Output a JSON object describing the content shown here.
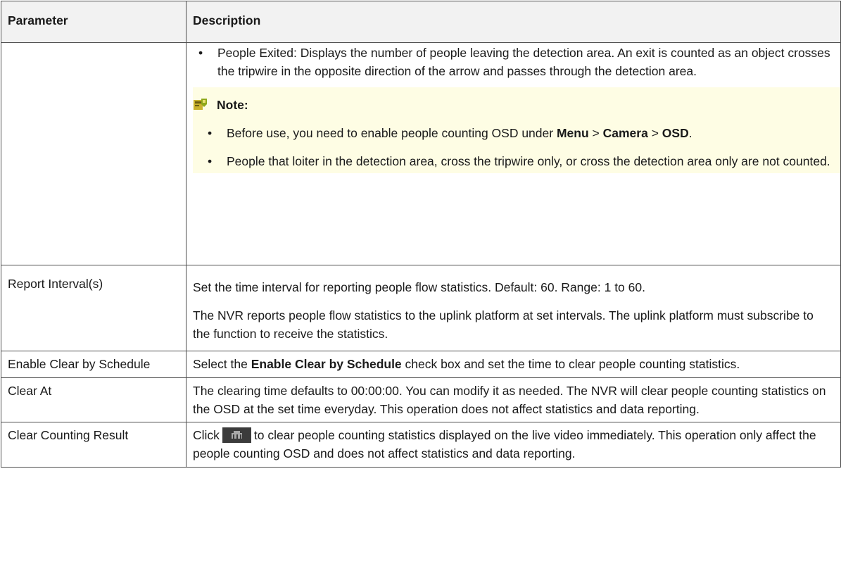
{
  "table": {
    "headers": {
      "parameter": "Parameter",
      "description": "Description"
    },
    "row1": {
      "param": "",
      "bullet": "People Exited: Displays the number of people leaving the detection area. An exit is counted as an object crosses the tripwire in the opposite direction of the arrow and passes through the detection area.",
      "note_title": "Note:",
      "note_item1": {
        "t1": "Before use, you need to enable people counting OSD under ",
        "b1": "Menu",
        "t2": " > ",
        "b2": "Camera",
        "t3": " > ",
        "b3": "OSD",
        "t4": "."
      },
      "note_item2": "People that loiter in the detection area, cross the tripwire only, or cross the detection area only are not counted."
    },
    "row2": {
      "param": "Report Interval(s)",
      "p1": "Set the time interval for reporting people flow statistics. Default: 60. Range: 1 to 60.",
      "p2": "The NVR reports people flow statistics to the uplink platform at set intervals. The uplink platform must subscribe to the function to receive the statistics."
    },
    "row3": {
      "param": "Enable Clear by Schedule",
      "t1": "Select the ",
      "b1": "Enable Clear by Schedule",
      "t2": " check box and set the time to clear people counting statistics."
    },
    "row4": {
      "param": "Clear At",
      "p1": "The clearing time defaults to 00:00:00. You can modify it as needed. The NVR will clear people counting statistics on the OSD at the set time everyday. This operation does not affect statistics and data reporting."
    },
    "row5": {
      "param": "Clear Counting Result",
      "t1": "Click",
      "t2": "to clear people counting statistics displayed on the live video immediately. This operation only affect the people counting OSD and does not affect statistics and data reporting."
    }
  },
  "icons": {
    "note": "note-icon",
    "clear": "clear-counting-icon"
  },
  "colors": {
    "header_bg": "#f2f2f2",
    "note_bg": "#fefde4",
    "border": "#4d4d4d"
  }
}
